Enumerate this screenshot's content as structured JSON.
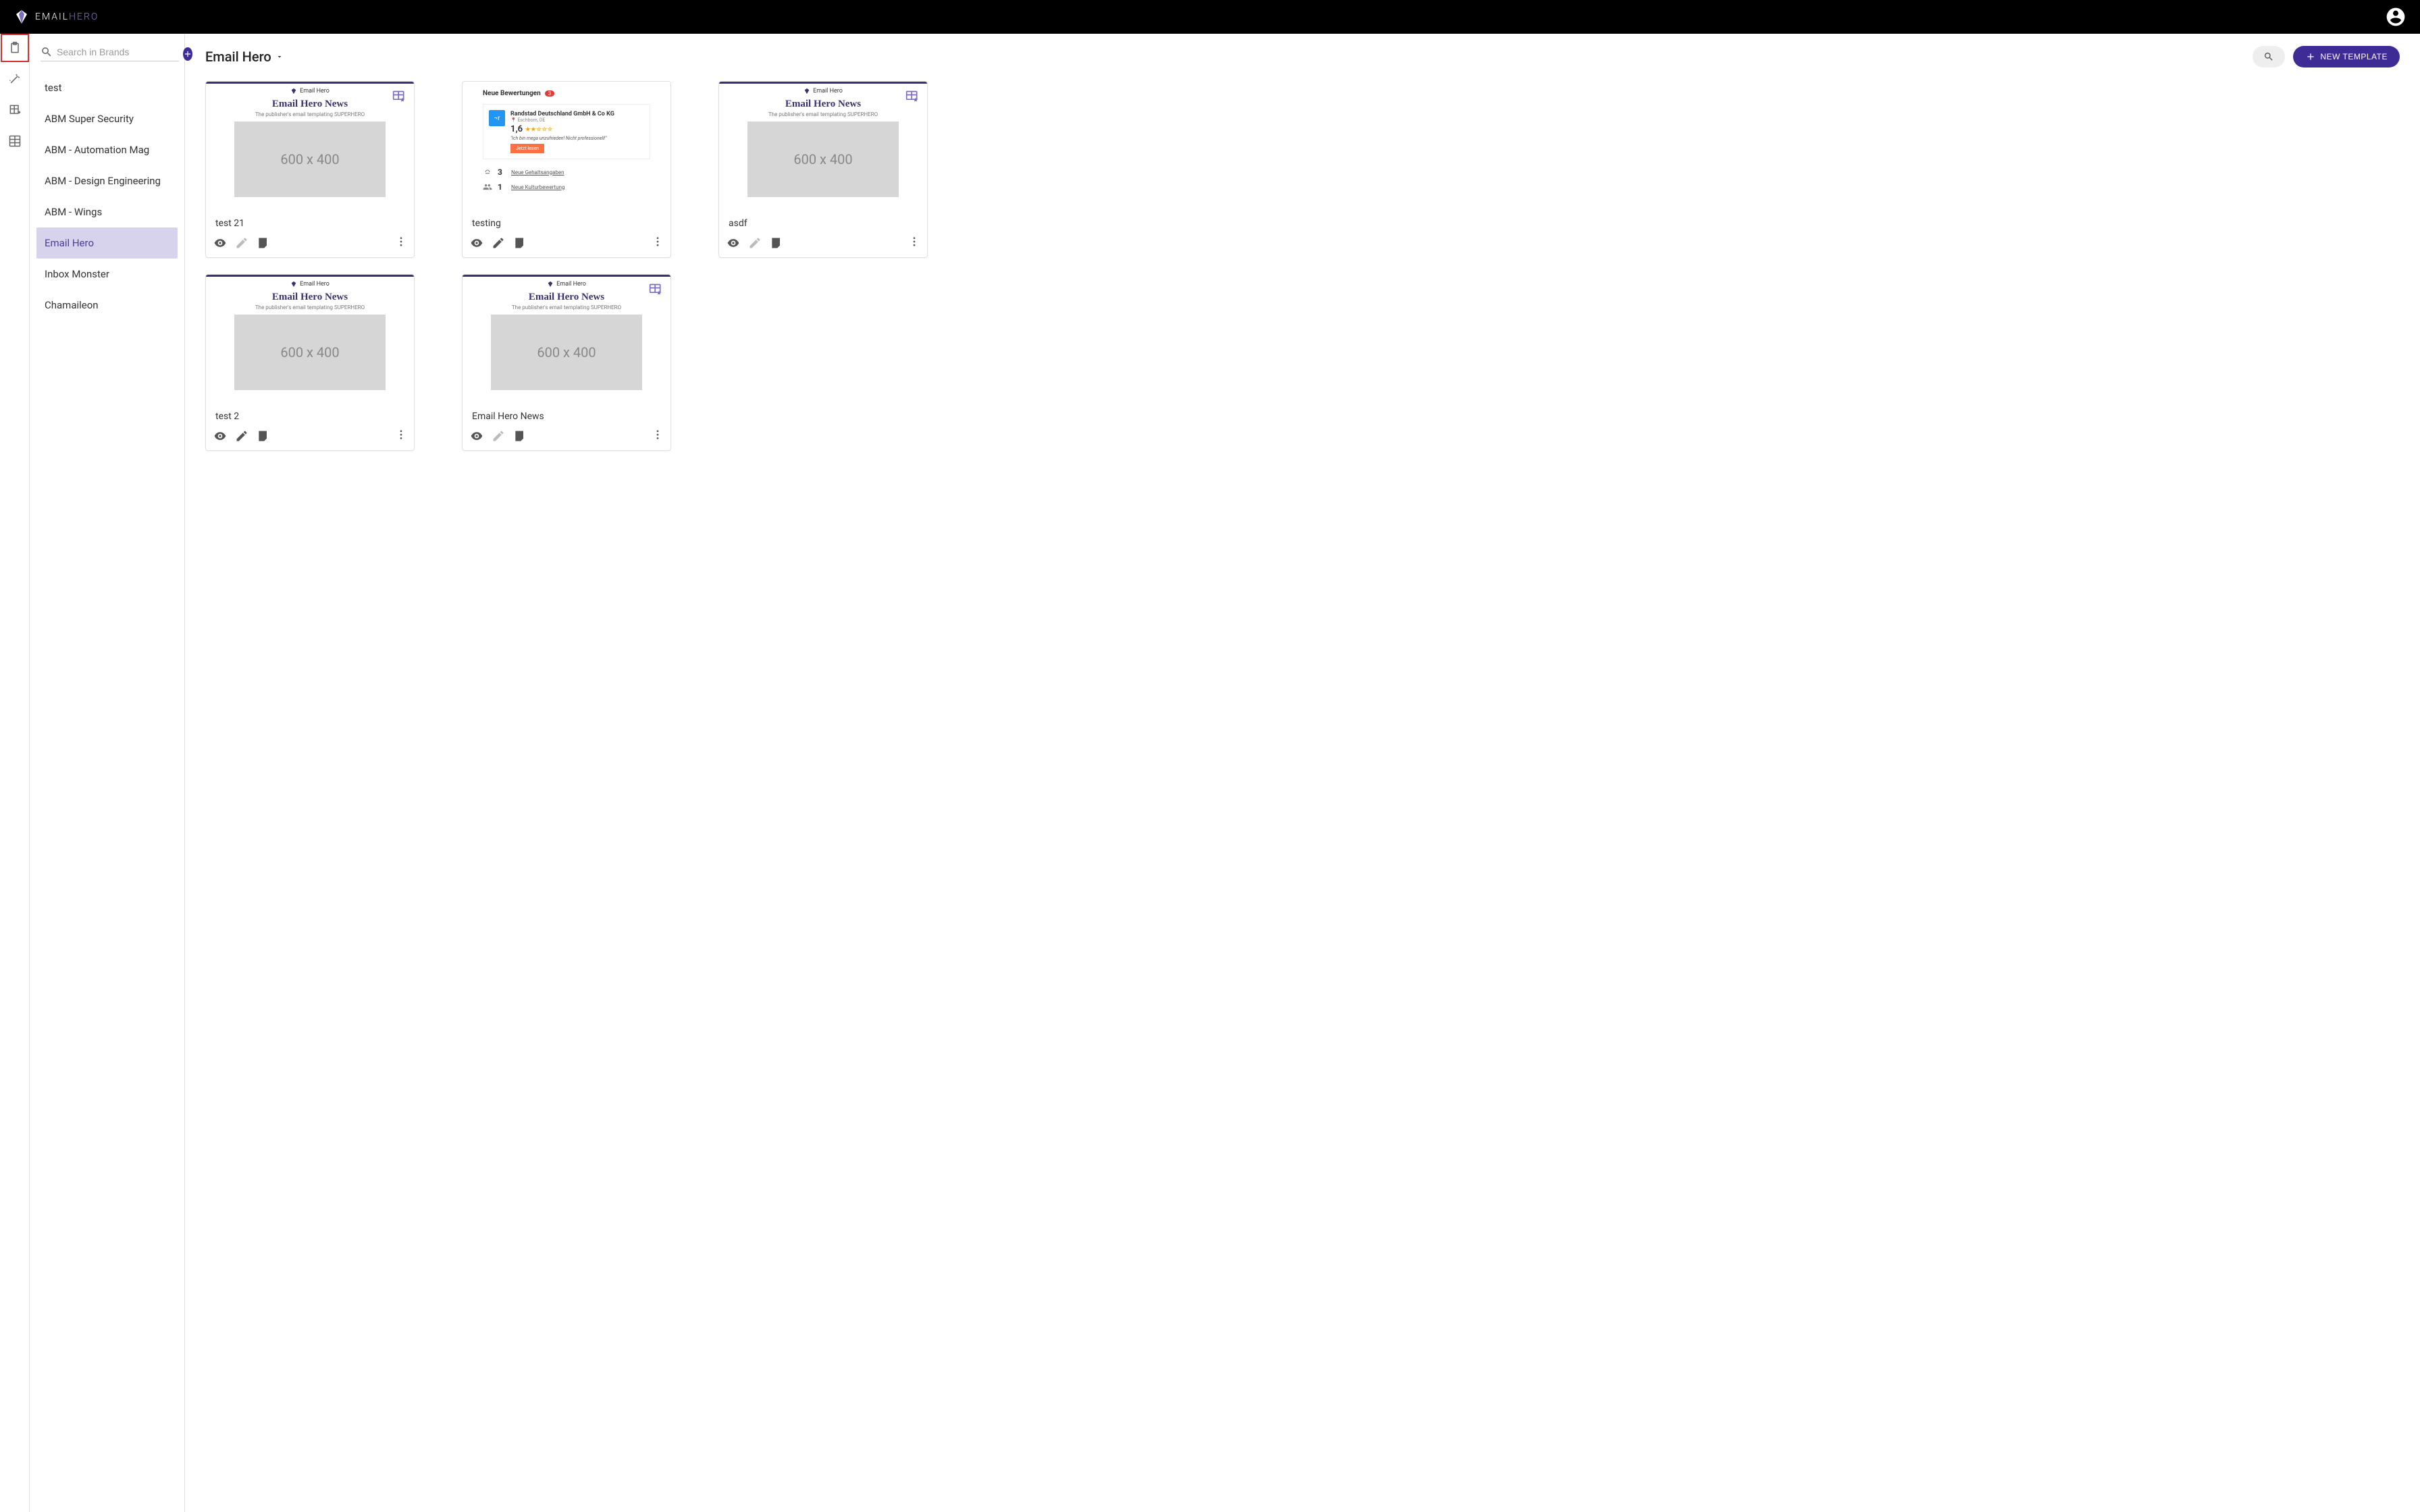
{
  "header": {
    "logo_main": "EMAIL",
    "logo_accent": "HERO"
  },
  "sidebar": {
    "search_placeholder": "Search in Brands",
    "brands": [
      {
        "label": "test"
      },
      {
        "label": "ABM Super Security"
      },
      {
        "label": "ABM - Automation Mag"
      },
      {
        "label": "ABM - Design Engineering"
      },
      {
        "label": "ABM - Wings"
      },
      {
        "label": "Email Hero"
      },
      {
        "label": "Inbox Monster"
      },
      {
        "label": "Chamaileon"
      }
    ],
    "selected_index": 5
  },
  "main": {
    "title": "Email Hero",
    "new_button": "NEW TEMPLATE"
  },
  "preview_hero": {
    "brand": "Email Hero",
    "heading": "Email Hero News",
    "sub": "The publisher's email templating SUPERHERO",
    "img": "600 x 400"
  },
  "preview_review": {
    "heading": "Neue Bewertungen",
    "badge": "3",
    "company": "Randstad Deutschland GmbH & Co KG",
    "location": "Eschborn, DE",
    "score": "1,6",
    "quote": "\"Ich bin mega unzufrieden! Nicht professionell!\"",
    "button": "Jetzt lesen",
    "row1_count": "3",
    "row1_label": "Neue Gehaltsangaben",
    "row2_count": "1",
    "row2_label": "Neue Kulturbewertung"
  },
  "templates": [
    {
      "title": "test 21",
      "preview": "hero",
      "badge": true,
      "edit_enabled": false
    },
    {
      "title": "testing",
      "preview": "review",
      "badge": false,
      "edit_enabled": true
    },
    {
      "title": "asdf",
      "preview": "hero",
      "badge": true,
      "edit_enabled": false
    },
    {
      "title": "test 2",
      "preview": "hero",
      "badge": false,
      "edit_enabled": true
    },
    {
      "title": "Email Hero News",
      "preview": "hero",
      "badge": true,
      "edit_enabled": false
    }
  ]
}
